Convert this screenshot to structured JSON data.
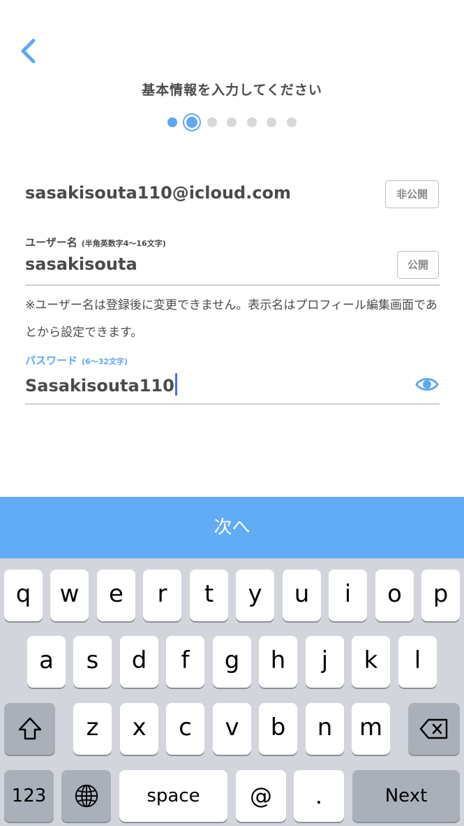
{
  "header": {
    "title": "基本情報を入力してください",
    "steps_total": 7,
    "current_step": 2
  },
  "form": {
    "email": "sasakisouta110@icloud.com",
    "email_visibility": "非公開",
    "username_label": "ユーザー名",
    "username_hint": "(半角英数字4〜16文字)",
    "username_value": "sasakisouta",
    "username_visibility": "公開",
    "note": "※ユーザー名は登録後に変更できません。表示名はプロフィール編集画面であとから設定できます。",
    "password_label": "パスワード",
    "password_hint": "(6〜32文字)",
    "password_value": "Sasakisouta110"
  },
  "next_button": "次へ",
  "keyboard": {
    "row1": [
      "q",
      "w",
      "e",
      "r",
      "t",
      "y",
      "u",
      "i",
      "o",
      "p"
    ],
    "row2": [
      "a",
      "s",
      "d",
      "f",
      "g",
      "h",
      "j",
      "k",
      "l"
    ],
    "row3": [
      "z",
      "x",
      "c",
      "v",
      "b",
      "n",
      "m"
    ],
    "numbers_key": "123",
    "space_key": "space",
    "at_key": "@",
    "dot_key": ".",
    "return_key": "Next"
  },
  "colors": {
    "accent": "#5ea8f2",
    "button": "#62abf5",
    "keyboard_bg": "#d2d5db"
  }
}
